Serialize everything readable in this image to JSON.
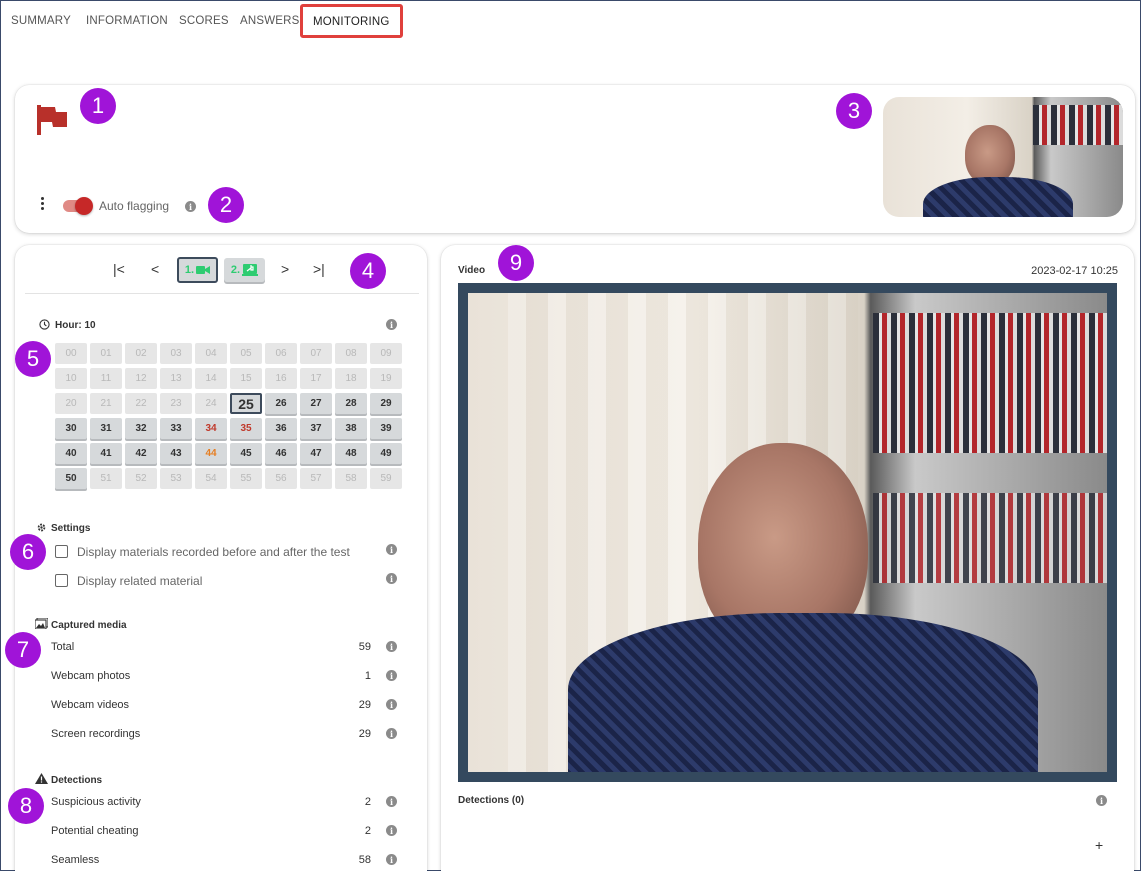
{
  "tabs": [
    "SUMMARY",
    "INFORMATION",
    "SCORES",
    "ANSWERS",
    "MONITORING"
  ],
  "badges": [
    "1",
    "2",
    "3",
    "4",
    "5",
    "6",
    "7",
    "8",
    "9"
  ],
  "top_card": {
    "auto_flagging_label": "Auto flagging",
    "auto_flagging_on": true
  },
  "media_nav": {
    "item1_label": "1.",
    "item2_label": "2."
  },
  "hour": {
    "label": "Hour: 10",
    "selected": "25",
    "cells": [
      {
        "v": "00",
        "s": "off"
      },
      {
        "v": "01",
        "s": "off"
      },
      {
        "v": "02",
        "s": "off"
      },
      {
        "v": "03",
        "s": "off"
      },
      {
        "v": "04",
        "s": "off"
      },
      {
        "v": "05",
        "s": "off"
      },
      {
        "v": "06",
        "s": "off"
      },
      {
        "v": "07",
        "s": "off"
      },
      {
        "v": "08",
        "s": "off"
      },
      {
        "v": "09",
        "s": "off"
      },
      {
        "v": "10",
        "s": "off"
      },
      {
        "v": "11",
        "s": "off"
      },
      {
        "v": "12",
        "s": "off"
      },
      {
        "v": "13",
        "s": "off"
      },
      {
        "v": "14",
        "s": "off"
      },
      {
        "v": "15",
        "s": "off"
      },
      {
        "v": "16",
        "s": "off"
      },
      {
        "v": "17",
        "s": "off"
      },
      {
        "v": "18",
        "s": "off"
      },
      {
        "v": "19",
        "s": "off"
      },
      {
        "v": "20",
        "s": "off"
      },
      {
        "v": "21",
        "s": "off"
      },
      {
        "v": "22",
        "s": "off"
      },
      {
        "v": "23",
        "s": "off"
      },
      {
        "v": "24",
        "s": "off"
      },
      {
        "v": "25",
        "s": "sel"
      },
      {
        "v": "26",
        "s": "on"
      },
      {
        "v": "27",
        "s": "on"
      },
      {
        "v": "28",
        "s": "on"
      },
      {
        "v": "29",
        "s": "on"
      },
      {
        "v": "30",
        "s": "on"
      },
      {
        "v": "31",
        "s": "on"
      },
      {
        "v": "32",
        "s": "on"
      },
      {
        "v": "33",
        "s": "on"
      },
      {
        "v": "34",
        "s": "red"
      },
      {
        "v": "35",
        "s": "red"
      },
      {
        "v": "36",
        "s": "on"
      },
      {
        "v": "37",
        "s": "on"
      },
      {
        "v": "38",
        "s": "on"
      },
      {
        "v": "39",
        "s": "on"
      },
      {
        "v": "40",
        "s": "on"
      },
      {
        "v": "41",
        "s": "on"
      },
      {
        "v": "42",
        "s": "on"
      },
      {
        "v": "43",
        "s": "on"
      },
      {
        "v": "44",
        "s": "orange"
      },
      {
        "v": "45",
        "s": "on"
      },
      {
        "v": "46",
        "s": "on"
      },
      {
        "v": "47",
        "s": "on"
      },
      {
        "v": "48",
        "s": "on"
      },
      {
        "v": "49",
        "s": "on"
      },
      {
        "v": "50",
        "s": "on"
      },
      {
        "v": "51",
        "s": "off"
      },
      {
        "v": "52",
        "s": "off"
      },
      {
        "v": "53",
        "s": "off"
      },
      {
        "v": "54",
        "s": "off"
      },
      {
        "v": "55",
        "s": "off"
      },
      {
        "v": "56",
        "s": "off"
      },
      {
        "v": "57",
        "s": "off"
      },
      {
        "v": "58",
        "s": "off"
      },
      {
        "v": "59",
        "s": "off"
      }
    ]
  },
  "settings": {
    "title": "Settings",
    "option1": "Display materials recorded before and after the test",
    "option2": "Display related material"
  },
  "captured_media": {
    "title": "Captured media",
    "rows": [
      {
        "label": "Total",
        "value": "59"
      },
      {
        "label": "Webcam photos",
        "value": "1"
      },
      {
        "label": "Webcam videos",
        "value": "29"
      },
      {
        "label": "Screen recordings",
        "value": "29"
      }
    ]
  },
  "detections": {
    "title": "Detections",
    "rows": [
      {
        "label": "Suspicious activity",
        "value": "2"
      },
      {
        "label": "Potential cheating",
        "value": "2"
      },
      {
        "label": "Seamless",
        "value": "58"
      }
    ]
  },
  "video_panel": {
    "title": "Video",
    "timestamp": "2023-02-17 10:25",
    "detections_label": "Detections (0)",
    "add_symbol": "+"
  },
  "colors": {
    "accent_purple": "#a014d8",
    "flag_red": "#b8302a",
    "toggle_red": "#c62828",
    "highlight_red": "#e0403c",
    "video_frame": "#34495e",
    "nav_green": "#2ecc71"
  }
}
